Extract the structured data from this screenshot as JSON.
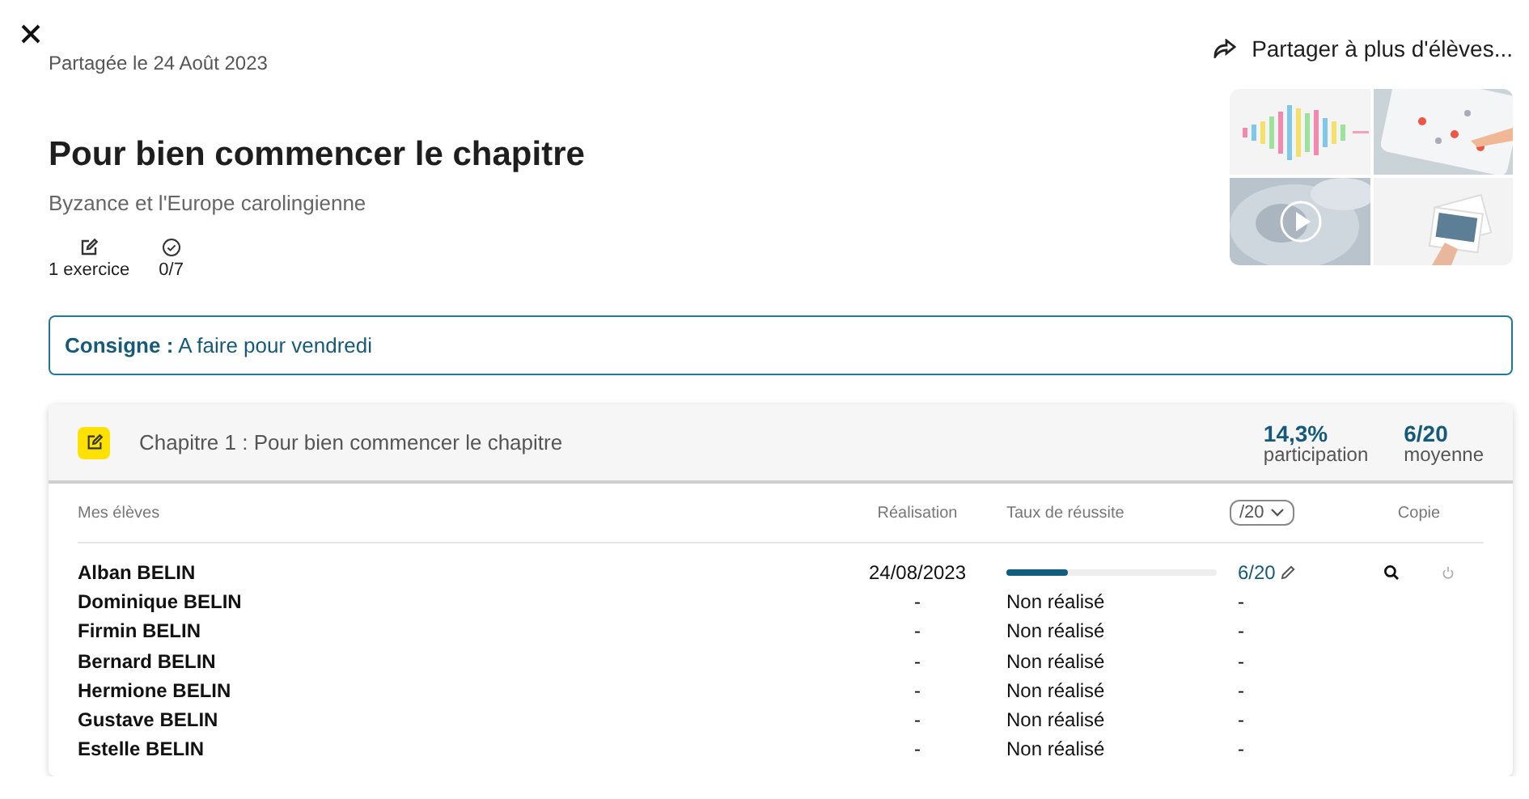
{
  "shared_date": "Partagée le 24 Août 2023",
  "share_action": "Partager à plus d'élèves...",
  "title": "Pour bien commencer le chapitre",
  "subtitle": "Byzance et l'Europe carolingienne",
  "stats": [
    {
      "kind": "exercises",
      "text": "1 exercice"
    },
    {
      "kind": "done",
      "text": "0/7"
    }
  ],
  "instruction": {
    "label": "Consigne :",
    "text": "A faire pour vendredi"
  },
  "chapter": {
    "title": "Chapitre 1 : Pour bien commencer le chapitre",
    "metrics": [
      {
        "value": "14,3%",
        "label": "participation"
      },
      {
        "value": "6/20",
        "label": "moyenne"
      }
    ],
    "columns": {
      "students": "Mes élèves",
      "completion": "Réalisation",
      "success": "Taux de réussite",
      "scale": "/20",
      "copy": "Copie"
    },
    "rows": [
      {
        "kind": "done",
        "name": "Alban BELIN",
        "completion": "24/08/2023",
        "level": 0.29,
        "score": "6/20"
      },
      {
        "kind": "pending",
        "name": "Dominique BELIN",
        "completion": "-",
        "status": "Non réalisé",
        "score": "-"
      },
      {
        "kind": "pending",
        "name": "Firmin BELIN",
        "completion": "-",
        "status": "Non réalisé",
        "score": "-"
      },
      {
        "kind": "pending",
        "name": "Bernard BELIN",
        "completion": "-",
        "status": "Non réalisé",
        "score": "-"
      },
      {
        "kind": "pending",
        "name": "Hermione BELIN",
        "completion": "-",
        "status": "Non réalisé",
        "score": "-"
      },
      {
        "kind": "pending",
        "name": "Gustave BELIN",
        "completion": "-",
        "status": "Non réalisé",
        "score": "-"
      },
      {
        "kind": "pending",
        "name": "Estelle BELIN",
        "completion": "-",
        "status": "Non réalisé",
        "score": "-"
      }
    ]
  }
}
